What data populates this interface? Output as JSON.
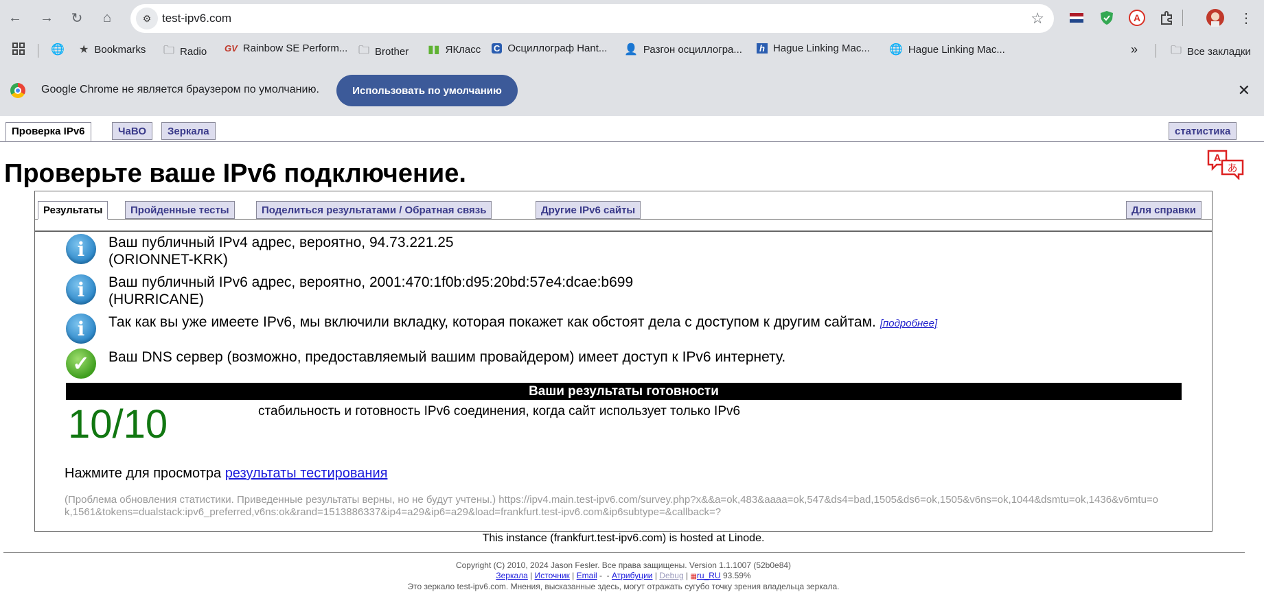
{
  "browser": {
    "url": "test-ipv6.com",
    "bookmarks": [
      {
        "label": "Bookmarks",
        "icon": "star-icon"
      },
      {
        "label": "Radio",
        "icon": "folder-icon"
      },
      {
        "label": "Rainbow SE Perform...",
        "icon": "gv-icon"
      },
      {
        "label": "Brother",
        "icon": "folder-icon"
      },
      {
        "label": "ЯКласс",
        "icon": "yaklass-icon"
      },
      {
        "label": "Осциллограф Hant...",
        "icon": "c-icon"
      },
      {
        "label": "Разгон осциллогра...",
        "icon": "person-icon"
      },
      {
        "label": "Hague Linking Mac...",
        "icon": "h-icon"
      },
      {
        "label": "Hague Linking Mac...",
        "icon": "globe-icon"
      }
    ],
    "all_bookmarks": "Все закладки",
    "infobar": {
      "message": "Google Chrome не является браузером по умолчанию.",
      "button": "Использовать по умолчанию"
    }
  },
  "page": {
    "tabs": [
      "Проверка IPv6",
      "ЧаВО",
      "Зеркала"
    ],
    "stats_tab": "статистика",
    "title": "Проверьте ваше IPv6 подключение.",
    "subtabs": [
      "Результаты",
      "Пройденные тесты",
      "Поделиться результатами / Обратная связь",
      "Другие IPv6 сайты"
    ],
    "help_tab": "Для справки",
    "info": [
      {
        "line1": "Ваш публичный IPv4 адрес, вероятно, 94.73.221.25",
        "line2": "(ORIONNET-KRK)"
      },
      {
        "line1": "Ваш публичный IPv6 адрес, вероятно, 2001:470:1f0b:d95:20bd:57e4:dcae:b699",
        "line2": "(HURRICANE)"
      },
      {
        "line1": "Так как вы уже имеете IPv6, мы включили вкладку, которая покажет как обстоят дела с доступом к другим сайтам.",
        "link": "[подробнее]"
      },
      {
        "line1": "Ваш DNS сервер (возможно, предоставляемый вашим провайдером) имеет доступ к IPv6 интернету."
      }
    ],
    "readiness_header": "Ваши результаты готовности",
    "score": "10/10",
    "score_desc": "стабильность и готовность IPv6 соединения, когда сайт использует только IPv6",
    "view_prefix": "Нажмите для просмотра",
    "view_link": "результаты тестирования",
    "survey_note": "(Проблема обновления статистики. Приведенные результаты верны, но не будут учтены.) https://ipv4.main.test-ipv6.com/survey.php?x&&a=ok,483&aaaa=ok,547&ds4=bad,1505&ds6=ok,1505&v6ns=ok,1044&dsmtu=ok,1436&v6mtu=ok,1561&tokens=dualstack:ipv6_preferred,v6ns:ok&rand=1513886337&ip4=a29&ip6=a29&load=frankfurt.test-ipv6.com&ip6subtype=&callback=?",
    "hosted": "This instance (frankfurt.test-ipv6.com) is hosted at Linode.",
    "footer": {
      "copyright": "Copyright (C) 2010, 2024 Jason Fesler. Все права защищены. Version 1.1.1007 (52b0e84)",
      "links": [
        "Зеркала",
        "Источник",
        "Email",
        "Атрибуции",
        "Debug",
        "ru_RU"
      ],
      "locale_pct": "93.59%",
      "mirror_note": "Это зеркало test-ipv6.com. Мнения, высказанные здесь, могут отражать сугубо точку зрения владельца зеркала."
    }
  }
}
